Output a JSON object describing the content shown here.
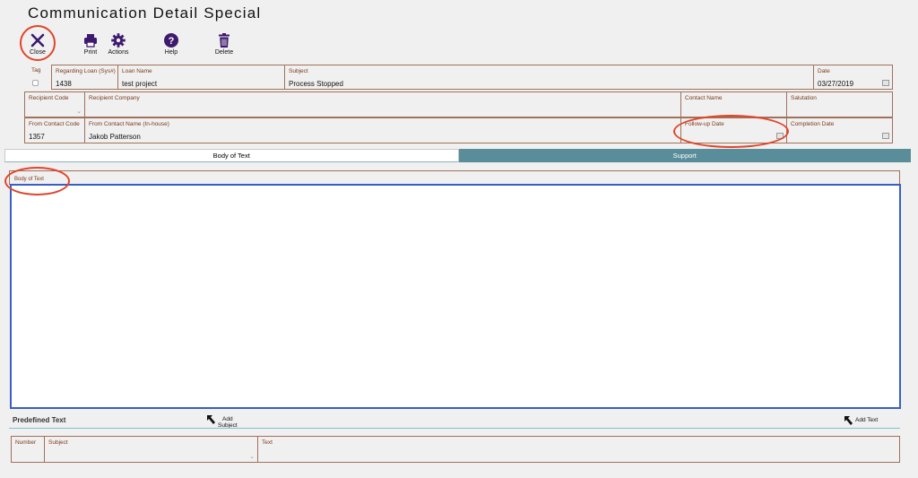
{
  "window": {
    "title": "Communication Detail Special"
  },
  "toolbar": {
    "close_label": "Close",
    "print_label": "Print",
    "actions_label": "Actions",
    "help_label": "Help",
    "delete_label": "Delete"
  },
  "row1": {
    "tag_label": "Tag",
    "tag_checked": false,
    "loan_label": "Regarding Loan (Sys#)",
    "loan_value": "1438",
    "loan_name_label": "Loan Name",
    "loan_name_value": "test project",
    "subject_label": "Subject",
    "subject_value": "Process Stopped",
    "date_label": "Date",
    "date_value": "03/27/2019"
  },
  "row2": {
    "recipient_code_label": "Recipient Code",
    "recipient_company_label": "Recipient Company",
    "contact_name_label": "Contact Name",
    "salutation_label": "Salutation"
  },
  "row3": {
    "from_code_label": "From Contact Code",
    "from_code_value": "1357",
    "from_name_label": "From Contact Name (In-house)",
    "from_name_value": "Jakob Patterson",
    "followup_label": "Follow-up Date",
    "completion_label": "Completion Date"
  },
  "tabs": [
    {
      "label": "Body of Text",
      "active": true
    },
    {
      "label": "Support",
      "active": false
    }
  ],
  "body_of_text": {
    "label": "Body of Text",
    "value": ""
  },
  "predefined": {
    "title": "Predefined Text",
    "add_subject_line1": "Add",
    "add_subject_line2": "Subject",
    "add_text_label": "Add Text",
    "columns": {
      "number": "Number",
      "subject": "Subject",
      "text": "Text"
    }
  },
  "annotation_color": "#e0452b",
  "accent_color": "#5a8d9a",
  "icon_color": "#3d1a6e"
}
